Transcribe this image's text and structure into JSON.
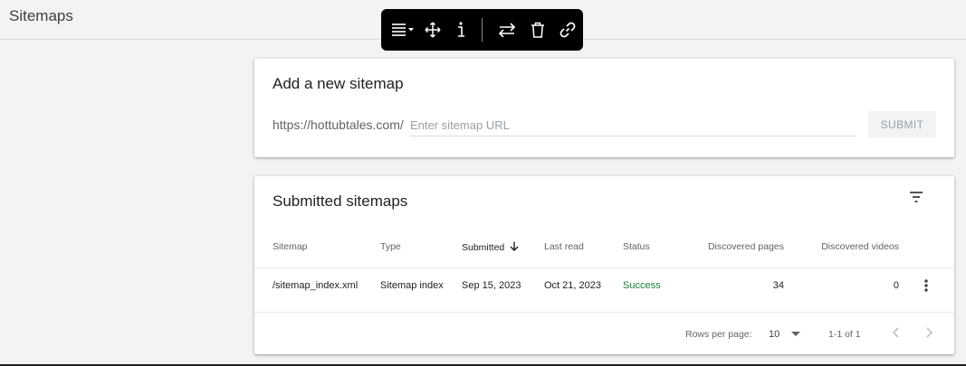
{
  "page": {
    "title": "Sitemaps"
  },
  "toolbar": {
    "icons": [
      "align-menu-icon",
      "move-icon",
      "info-icon",
      "swap-icon",
      "trash-icon",
      "link-icon"
    ]
  },
  "add_sitemap": {
    "title": "Add a new sitemap",
    "url_prefix": "https://hottubtales.com/",
    "placeholder": "Enter sitemap URL",
    "value": "",
    "submit_label": "SUBMIT"
  },
  "submitted": {
    "title": "Submitted sitemaps",
    "columns": [
      "Sitemap",
      "Type",
      "Submitted",
      "Last read",
      "Status",
      "Discovered pages",
      "Discovered videos"
    ],
    "sorted_column": "Submitted",
    "sort_direction": "descending",
    "rows": [
      {
        "sitemap": "/sitemap_index.xml",
        "type": "Sitemap index",
        "submitted": "Sep 15, 2023",
        "last_read": "Oct 21, 2023",
        "status": "Success",
        "discovered_pages": "34",
        "discovered_videos": "0"
      }
    ],
    "footer": {
      "rows_per_page_label": "Rows per page:",
      "rows_per_page": "10",
      "range": "1-1 of 1"
    }
  },
  "colors": {
    "success": "#188038",
    "background": "#f1f3f4",
    "toolbar": "#000000"
  }
}
